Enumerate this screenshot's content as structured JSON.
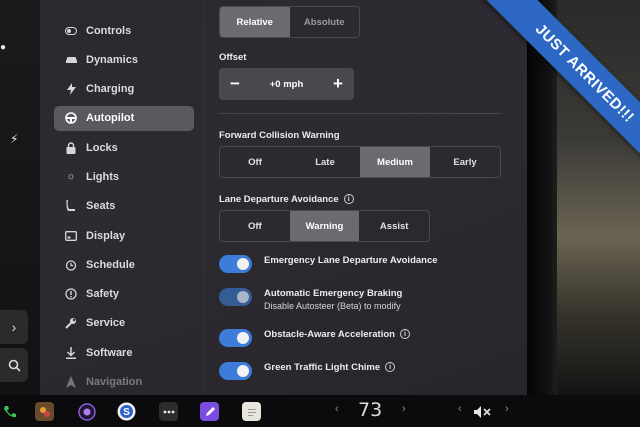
{
  "sidebar": {
    "items": [
      {
        "label": "Controls",
        "icon": "toggle-icon"
      },
      {
        "label": "Dynamics",
        "icon": "car-icon"
      },
      {
        "label": "Charging",
        "icon": "lightning-icon"
      },
      {
        "label": "Autopilot",
        "icon": "steering-wheel-icon",
        "active": true
      },
      {
        "label": "Locks",
        "icon": "lock-icon"
      },
      {
        "label": "Lights",
        "icon": "sun-icon"
      },
      {
        "label": "Seats",
        "icon": "seat-icon"
      },
      {
        "label": "Display",
        "icon": "display-icon"
      },
      {
        "label": "Schedule",
        "icon": "alarm-clock-icon"
      },
      {
        "label": "Safety",
        "icon": "info-circle-icon"
      },
      {
        "label": "Service",
        "icon": "wrench-icon"
      },
      {
        "label": "Software",
        "icon": "download-icon"
      },
      {
        "label": "Navigation",
        "icon": "navigation-arrow-icon"
      }
    ]
  },
  "speed_mode": {
    "options": [
      "Relative",
      "Absolute"
    ],
    "selected": "Relative"
  },
  "offset": {
    "label": "Offset",
    "value": "+0 mph",
    "minus": "−",
    "plus": "+"
  },
  "forward_collision_warning": {
    "label": "Forward Collision Warning",
    "options": [
      "Off",
      "Late",
      "Medium",
      "Early"
    ],
    "selected": "Medium"
  },
  "lane_departure_avoidance": {
    "label": "Lane Departure Avoidance",
    "options": [
      "Off",
      "Warning",
      "Assist"
    ],
    "selected": "Warning"
  },
  "toggles": {
    "emergency_lane": {
      "label": "Emergency Lane Departure Avoidance",
      "on": true
    },
    "aeb": {
      "label": "Automatic Emergency Braking",
      "sublabel": "Disable Autosteer (Beta) to modify",
      "on": true
    },
    "obstacle_aware": {
      "label": "Obstacle-Aware Acceleration",
      "on": true
    },
    "green_light_chime": {
      "label": "Green Traffic Light Chime",
      "on": true
    }
  },
  "taskbar": {
    "temperature": "73",
    "left_arrow": "‹",
    "right_arrow": "›",
    "volume_left": "‹",
    "volume_right": "›"
  },
  "banner": {
    "text": "JUST ARRIVED!!!"
  },
  "edge": {
    "chevron": "›"
  },
  "colors": {
    "accent_blue": "#3d7cd9",
    "banner_blue": "#2d68c4",
    "panel_bg": "#2d2a31"
  }
}
